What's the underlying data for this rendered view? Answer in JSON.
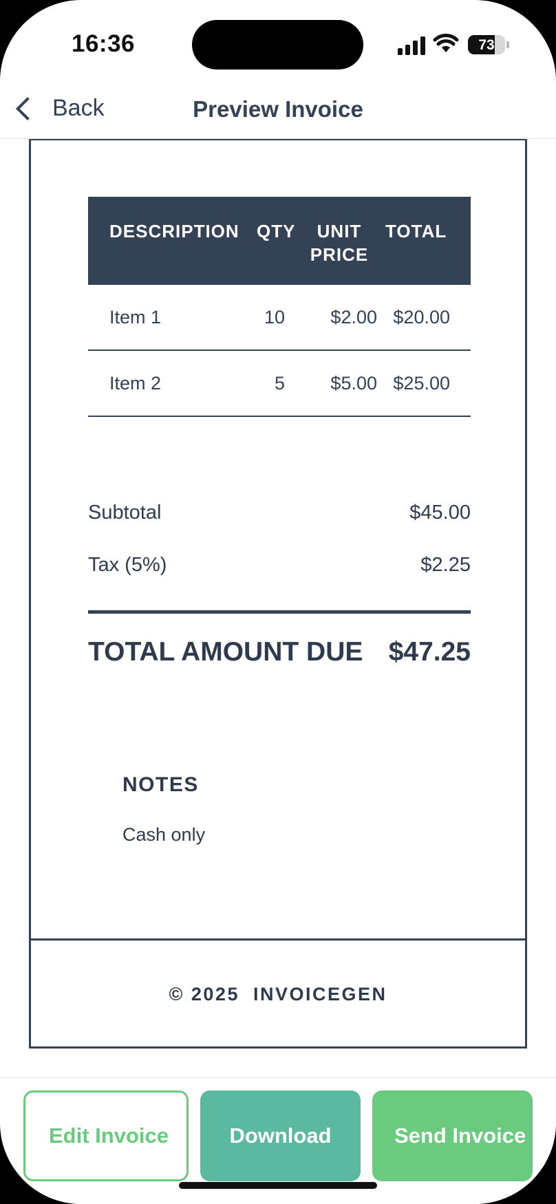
{
  "status": {
    "time": "16:36",
    "battery": "73"
  },
  "nav": {
    "back_label": "Back",
    "title": "Preview Invoice"
  },
  "table": {
    "headers": {
      "description": "DESCRIPTION",
      "qty": "QTY",
      "unit_price": "UNIT PRICE",
      "total": "TOTAL"
    },
    "rows": [
      {
        "description": "Item 1",
        "qty": "10",
        "unit_price": "$2.00",
        "total": "$20.00"
      },
      {
        "description": "Item 2",
        "qty": "5",
        "unit_price": "$5.00",
        "total": "$25.00"
      }
    ]
  },
  "summary": {
    "subtotal_label": "Subtotal",
    "subtotal_value": "$45.00",
    "tax_label": "Tax (5%)",
    "tax_value": "$2.25",
    "total_label": "TOTAL AMOUNT DUE",
    "total_value": "$47.25"
  },
  "notes": {
    "heading": "NOTES",
    "text": "Cash only"
  },
  "footer": {
    "text": "© 2025  INVOICEGEN"
  },
  "actions": {
    "edit": "Edit Invoice",
    "download": "Download",
    "send": "Send Invoice"
  },
  "colors": {
    "navy": "#344256",
    "green": "#6acb7e",
    "teal": "#5bb99f"
  }
}
